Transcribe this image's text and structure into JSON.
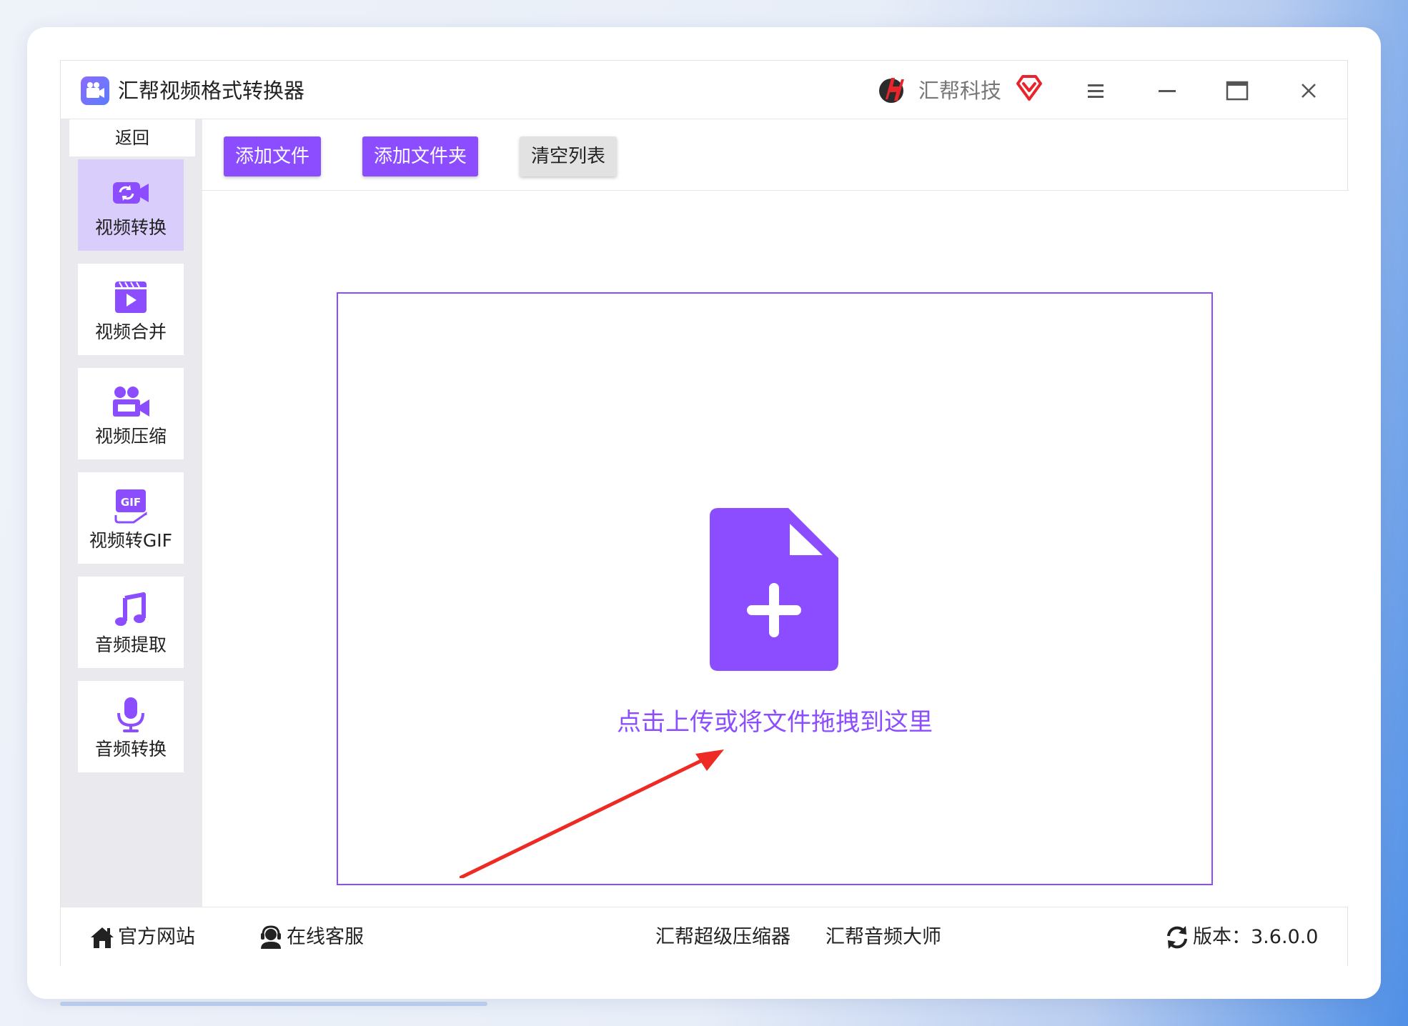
{
  "app": {
    "title": "汇帮视频格式转换器",
    "brand_name": "汇帮科技",
    "accent": "#8b4dff"
  },
  "window_controls": {
    "menu_icon": "hamburger-menu-icon",
    "minimize_icon": "minimize-icon",
    "maximize_icon": "maximize-icon",
    "close_icon": "close-icon"
  },
  "sidebar": {
    "back_label": "返回",
    "items": [
      {
        "label": "视频转换",
        "icon": "video-convert-icon",
        "active": true
      },
      {
        "label": "视频合并",
        "icon": "video-merge-icon",
        "active": false
      },
      {
        "label": "视频压缩",
        "icon": "video-compress-icon",
        "active": false
      },
      {
        "label": "视频转GIF",
        "icon": "gif-icon",
        "active": false
      },
      {
        "label": "音频提取",
        "icon": "music-note-icon",
        "active": false
      },
      {
        "label": "音频转换",
        "icon": "microphone-icon",
        "active": false
      }
    ]
  },
  "toolbar": {
    "add_file": "添加文件",
    "add_folder": "添加文件夹",
    "clear_list": "清空列表"
  },
  "dropzone": {
    "text": "点击上传或将文件拖拽到这里",
    "icon": "file-add-icon"
  },
  "footer": {
    "website": "官方网站",
    "support": "在线客服",
    "compressor": "汇帮超级压缩器",
    "audio_master": "汇帮音频大师",
    "version": "版本：3.6.0.0"
  }
}
